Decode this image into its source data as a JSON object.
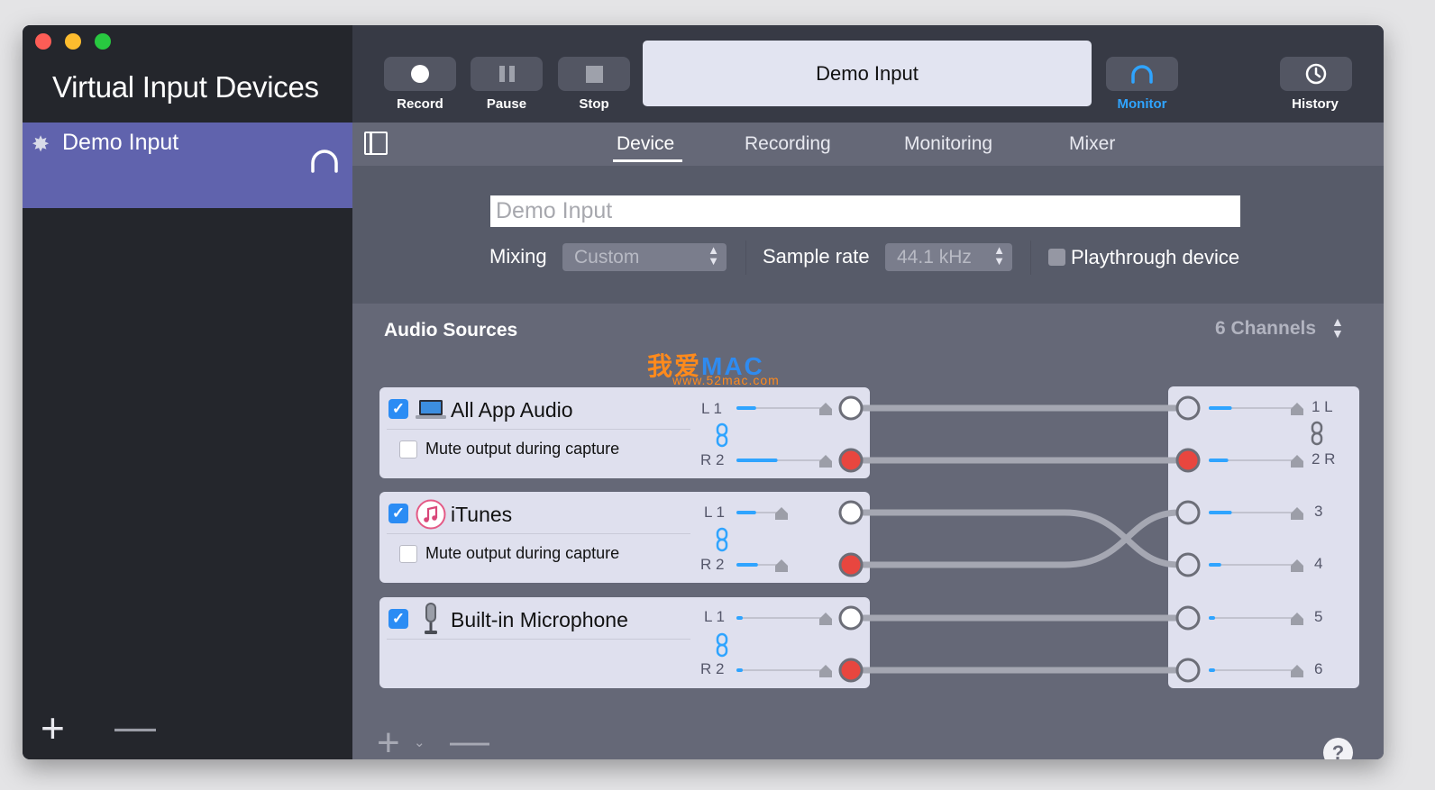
{
  "window": {
    "app_title": "Virtual Input Devices"
  },
  "sidebar": {
    "devices": [
      {
        "name": "Demo Input",
        "icon": "gear-icon",
        "monitor_icon": "headphones-icon"
      }
    ],
    "add_icon": "plus-icon",
    "remove_icon": "minus-icon"
  },
  "toolbar": {
    "record_label": "Record",
    "pause_label": "Pause",
    "stop_label": "Stop",
    "display_text": "Demo Input",
    "monitor_label": "Monitor",
    "history_label": "History",
    "accent": "#2fa4ff"
  },
  "tabs": [
    {
      "label": "Device",
      "active": true
    },
    {
      "label": "Recording",
      "active": false
    },
    {
      "label": "Monitoring",
      "active": false
    },
    {
      "label": "Mixer",
      "active": false
    }
  ],
  "device_settings": {
    "name_value": "Demo Input",
    "mixing_label": "Mixing",
    "mixing_value": "Custom",
    "sample_rate_label": "Sample rate",
    "sample_rate_value": "44.1 kHz",
    "playthrough_label": "Playthrough device",
    "playthrough_checked": false
  },
  "audio_sources": {
    "title": "Audio Sources",
    "channels_value": "6 Channels",
    "sources": [
      {
        "name": "All App Audio",
        "enabled": true,
        "icon": "laptop-icon",
        "mute_label": "Mute output during capture",
        "mute_checked": false,
        "channels": [
          {
            "label": "L 1",
            "level": 0.18
          },
          {
            "label": "R 2",
            "level": 0.42
          }
        ]
      },
      {
        "name": "iTunes",
        "enabled": true,
        "icon": "itunes-icon",
        "mute_label": "Mute output during capture",
        "mute_checked": false,
        "channels": [
          {
            "label": "L 1",
            "level": 0.18
          },
          {
            "label": "R 2",
            "level": 0.2
          }
        ]
      },
      {
        "name": "Built-in Microphone",
        "enabled": true,
        "icon": "microphone-icon",
        "channels": [
          {
            "label": "L 1",
            "level": 0.03
          },
          {
            "label": "R 2",
            "level": 0.03
          }
        ]
      }
    ],
    "outputs": [
      {
        "label": "1 L",
        "level": 0.22
      },
      {
        "label": "2 R",
        "level": 0.18
      },
      {
        "label": "3",
        "level": 0.22
      },
      {
        "label": "4",
        "level": 0.1
      },
      {
        "label": "5",
        "level": 0.03
      },
      {
        "label": "6",
        "level": 0.03
      }
    ],
    "routing": [
      [
        1,
        1
      ],
      [
        2,
        2
      ],
      [
        3,
        4
      ],
      [
        4,
        3
      ],
      [
        5,
        5
      ],
      [
        6,
        6
      ]
    ]
  },
  "watermark": {
    "line1_cn": "我爱",
    "line1_mac": "MAC",
    "line2": "www.52mac.com"
  }
}
